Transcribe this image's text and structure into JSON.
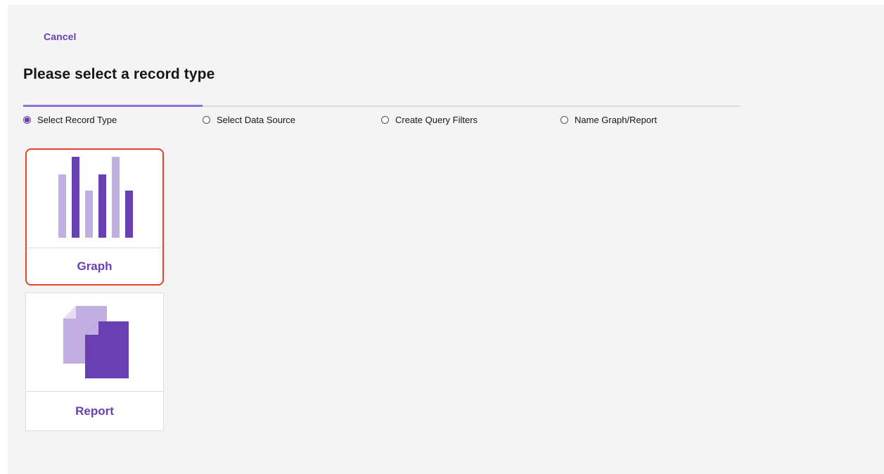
{
  "header": {
    "cancel_label": "Cancel",
    "title": "Please select a record type"
  },
  "progress": {
    "current_step": 1,
    "total_steps": 4,
    "steps": [
      {
        "label": "Select Record Type",
        "selected": true
      },
      {
        "label": "Select Data Source",
        "selected": false
      },
      {
        "label": "Create Query Filters",
        "selected": false
      },
      {
        "label": "Name Graph/Report",
        "selected": false
      }
    ]
  },
  "record_types": [
    {
      "label": "Graph",
      "icon": "bar-chart-icon",
      "highlighted": true
    },
    {
      "label": "Report",
      "icon": "document-icon",
      "highlighted": false
    }
  ],
  "colors": {
    "accent": "#6a3fb3",
    "accent_light": "#c1aee3",
    "highlight": "#e8412c",
    "progress_active": "#8f6fd6"
  }
}
